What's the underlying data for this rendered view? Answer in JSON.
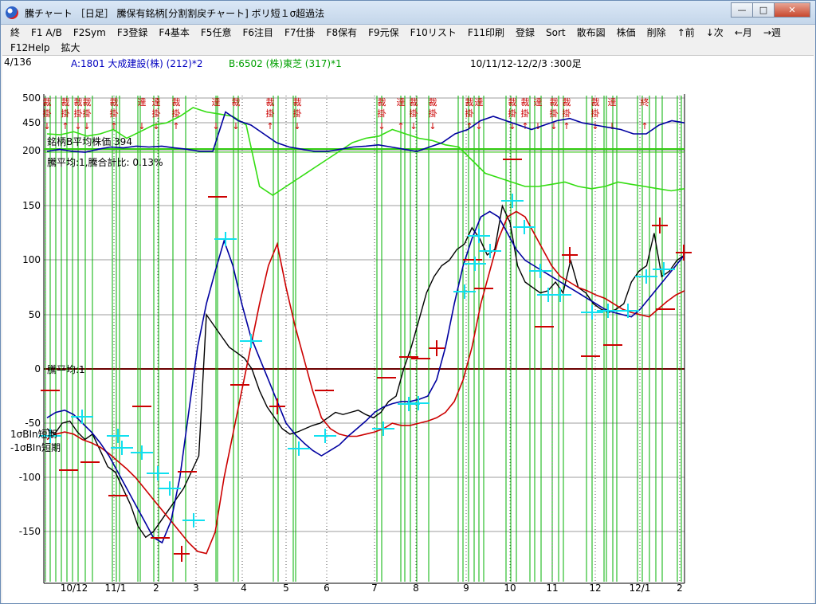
{
  "window": {
    "title": "騰チャート ［日足］ 騰保有銘柄[分割割戻チャート] ボリ短１σ超過法",
    "minimize_label": "—",
    "maximize_label": "□",
    "close_label": "✕"
  },
  "menu": {
    "row1": [
      "終",
      "F1 A/B",
      "F2Sym",
      "F3登録",
      "F4基本",
      "F5任意",
      "F6注目",
      "F7仕掛",
      "F8保有",
      "F9元保",
      "F10リスト",
      "F11印刷",
      "登録",
      "Sort",
      "散布図",
      "株価",
      "削除",
      "↑前",
      "↓次",
      "←月",
      "→週"
    ],
    "row2": [
      "F12Help",
      "拡大"
    ]
  },
  "info": {
    "counter": "4/136",
    "symbol_a": "A:1801 大成建設(株) (212)*2",
    "symbol_b": "B:6502 (株)東芝 (317)*1",
    "range": "10/11/12-12/2/3 :300足"
  },
  "labels": {
    "avg_price": "銘柄B平均株価 394",
    "ratio": "騰平均:1,騰合計比: 0.13%",
    "zero_line": "騰平均:1",
    "band_plus": "1σBIn短期",
    "band_minus": "-1σBIn短期"
  },
  "colors": {
    "grid": "#9e9e9e",
    "green_line": "#00b000",
    "green_series": "#33dd11",
    "blue_series": "#0000a0",
    "red_series": "#cc0000",
    "black_series": "#000000",
    "cyan_marks": "#10e0f0",
    "signal_text": "#cc0000",
    "zero_line": "#6b0000",
    "hline_green": "#33cc11"
  },
  "chart_data": {
    "type": "line",
    "y_ticks": [
      "500",
      "450",
      "200",
      "150",
      "100",
      "50",
      "0",
      "-50",
      "-100",
      "-150"
    ],
    "x_ticks": [
      "10/12",
      "11/1",
      "2",
      "3",
      "4",
      "5",
      "6",
      "7",
      "8",
      "9",
      "10",
      "11",
      "12",
      "12/1",
      "2"
    ],
    "signal_labels": [
      "裁掛",
      "裁掛",
      "裁掛",
      "裁掛",
      "裁掛",
      "達",
      "達掛",
      "裁掛",
      "達",
      "裁",
      "裁掛",
      "裁掛",
      "裁掛",
      "達",
      "裁掛",
      "裁掛",
      "裁掛",
      "達",
      "裁掛",
      "裁掛",
      "達",
      "裁掛",
      "裁掛",
      "裁掛",
      "達",
      "終"
    ],
    "lower_ylim": [
      -170,
      160
    ],
    "series": [
      {
        "values": [
          -55,
          -60,
          -50,
          -48,
          -58,
          -65,
          -60,
          -75,
          -90,
          -95,
          -110,
          -125,
          -145,
          -155,
          -150,
          -140,
          -130,
          -120,
          -110,
          -95,
          -80,
          50,
          40,
          30,
          20,
          15,
          10,
          0,
          -20,
          -35,
          -45,
          -55,
          -60,
          -58,
          -55,
          -52,
          -50,
          -45,
          -40,
          -42,
          -40,
          -38,
          -42,
          -45,
          -40,
          -30,
          -25,
          0,
          20,
          45,
          70,
          85,
          95,
          100,
          110,
          115,
          130,
          120,
          105,
          110,
          150,
          135,
          95,
          80,
          75,
          70,
          72,
          80,
          70,
          100,
          75,
          70,
          60,
          55,
          52,
          55,
          60,
          80,
          90,
          95,
          125,
          85,
          90,
          100,
          105
        ]
      },
      {
        "values": [
          -65,
          -60,
          -58,
          -60,
          -65,
          -68,
          -72,
          -78,
          -85,
          -92,
          -100,
          -110,
          -120,
          -130,
          -140,
          -150,
          -160,
          -168,
          -170,
          -150,
          -100,
          -60,
          -20,
          20,
          60,
          95,
          115,
          75,
          40,
          10,
          -20,
          -45,
          -55,
          -60,
          -62,
          -62,
          -60,
          -58,
          -55,
          -50,
          -52,
          -52,
          -50,
          -48,
          -45,
          -40,
          -30,
          -10,
          20,
          60,
          90,
          120,
          140,
          145,
          140,
          125,
          110,
          95,
          85,
          80,
          75,
          72,
          68,
          65,
          60,
          55,
          52,
          50,
          48,
          55,
          62,
          68,
          72
        ]
      },
      {
        "values": [
          -45,
          -40,
          -38,
          -42,
          -50,
          -58,
          -68,
          -80,
          -95,
          -110,
          -125,
          -140,
          -155,
          -160,
          -140,
          -100,
          -40,
          20,
          60,
          90,
          118,
          95,
          60,
          30,
          10,
          -10,
          -30,
          -50,
          -60,
          -68,
          -75,
          -80,
          -75,
          -70,
          -62,
          -55,
          -48,
          -40,
          -35,
          -32,
          -30,
          -30,
          -28,
          -25,
          -10,
          20,
          60,
          95,
          120,
          140,
          145,
          140,
          125,
          110,
          100,
          95,
          90,
          85,
          80,
          75,
          70,
          65,
          60,
          55,
          52,
          50,
          48,
          55,
          65,
          75,
          85,
          95,
          105
        ]
      },
      {
        "values": [
          420,
          418,
          425,
          415,
          420,
          430,
          410,
          425,
          440,
          445,
          460,
          480,
          470,
          465,
          460,
          440,
          300,
          280,
          300,
          320,
          340,
          360,
          380,
          400,
          410,
          415,
          430,
          420,
          410,
          405,
          395,
          390,
          360,
          330,
          320,
          310,
          300,
          300,
          305,
          310,
          300,
          295,
          300,
          310,
          305,
          300,
          295,
          290,
          295
        ]
      },
      {
        "values": [
          380,
          385,
          380,
          378,
          385,
          390,
          388,
          392,
          390,
          392,
          388,
          385,
          380,
          380,
          470,
          450,
          440,
          420,
          400,
          390,
          385,
          380,
          380,
          385,
          390,
          392,
          395,
          390,
          385,
          380,
          390,
          400,
          420,
          430,
          450,
          460,
          450,
          440,
          430,
          440,
          450,
          455,
          445,
          440,
          435,
          430,
          420,
          420,
          440,
          450,
          445
        ]
      }
    ]
  }
}
